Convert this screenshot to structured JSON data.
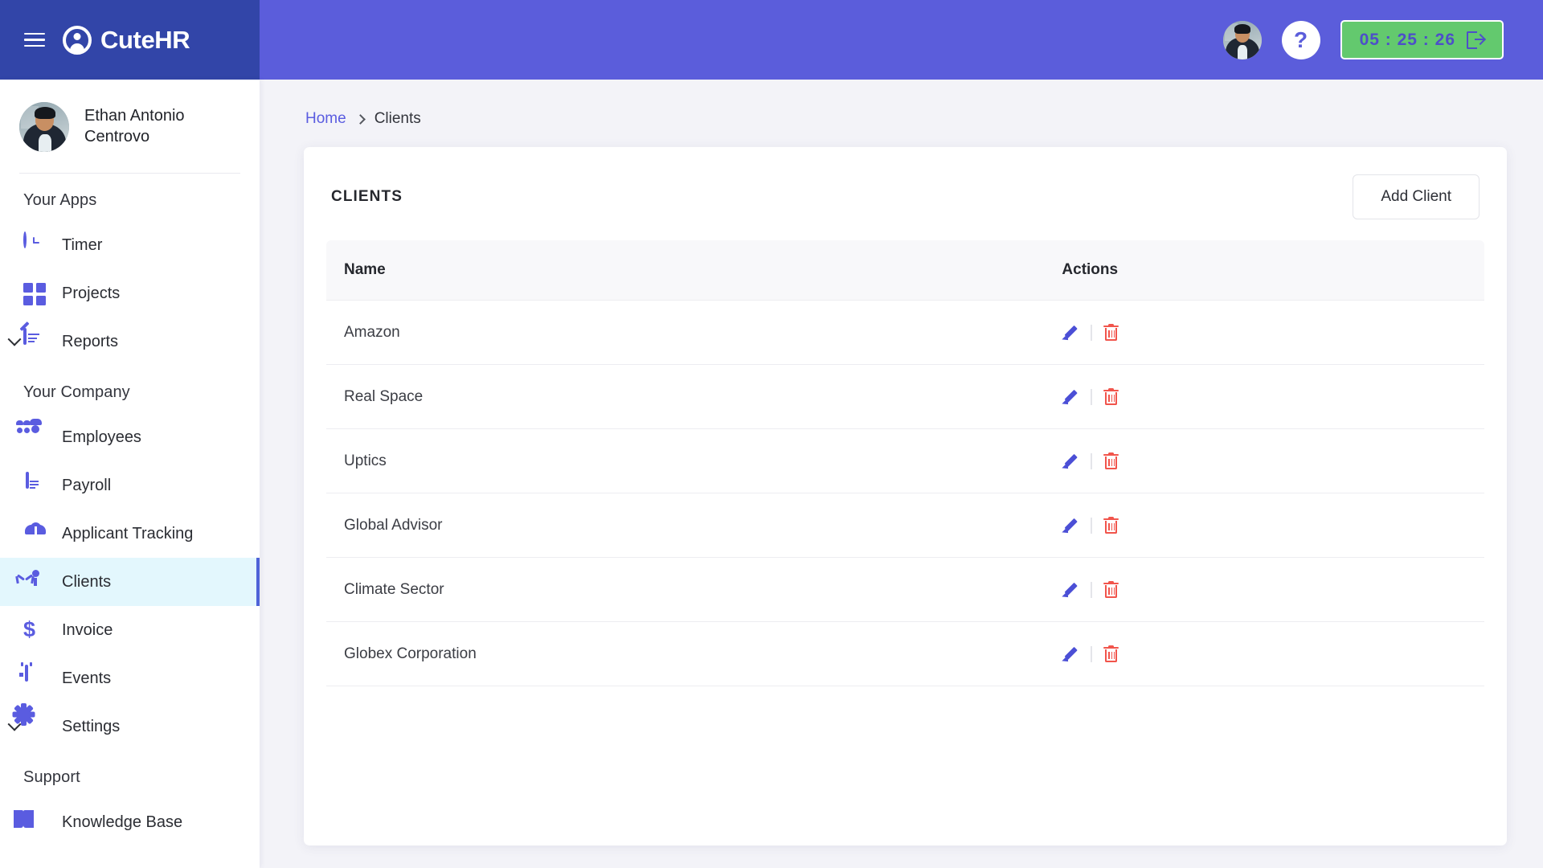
{
  "brand": {
    "name": "CuteHR",
    "collapse_icon": "collapse-sidebar-icon",
    "logo_icon": "cutehr-logo-icon"
  },
  "header": {
    "avatar_icon": "user-avatar",
    "help_icon": "help-question-icon",
    "timer": {
      "value": "05 : 25 : 26",
      "icon": "clock-out-icon"
    }
  },
  "sidebar": {
    "profile": {
      "name": "Ethan Antonio Centrovo",
      "avatar_icon": "profile-avatar"
    },
    "groups": [
      {
        "title": "Your Apps",
        "items": [
          {
            "label": "Timer",
            "icon": "clock-icon",
            "expandable": false,
            "active": false
          },
          {
            "label": "Projects",
            "icon": "grid-icon",
            "expandable": false,
            "active": false
          },
          {
            "label": "Reports",
            "icon": "report-edit-icon",
            "expandable": true,
            "active": false
          }
        ]
      },
      {
        "title": "Your Company",
        "items": [
          {
            "label": "Employees",
            "icon": "people-icon",
            "expandable": false,
            "active": false
          },
          {
            "label": "Payroll",
            "icon": "payroll-document-icon",
            "expandable": false,
            "active": false
          },
          {
            "label": "Applicant Tracking",
            "icon": "person-tie-icon",
            "expandable": false,
            "active": false
          },
          {
            "label": "Clients",
            "icon": "client-person-icon",
            "expandable": false,
            "active": true
          },
          {
            "label": "Invoice",
            "icon": "dollar-icon",
            "expandable": false,
            "active": false
          },
          {
            "label": "Events",
            "icon": "calendar-icon",
            "expandable": false,
            "active": false
          },
          {
            "label": "Settings",
            "icon": "gear-icon",
            "expandable": true,
            "active": false
          }
        ]
      },
      {
        "title": "Support",
        "items": [
          {
            "label": "Knowledge Base",
            "icon": "book-icon",
            "expandable": false,
            "active": false
          }
        ]
      }
    ]
  },
  "breadcrumb": {
    "home": "Home",
    "separator": "chevron-right-icon",
    "current": "Clients"
  },
  "card": {
    "title": "CLIENTS",
    "add_button": "Add Client",
    "columns": [
      "Name",
      "Actions"
    ],
    "rows": [
      {
        "name": "Amazon",
        "edit_icon": "edit-pencil-icon",
        "delete_icon": "trash-icon"
      },
      {
        "name": "Real Space",
        "edit_icon": "edit-pencil-icon",
        "delete_icon": "trash-icon"
      },
      {
        "name": "Uptics",
        "edit_icon": "edit-pencil-icon",
        "delete_icon": "trash-icon"
      },
      {
        "name": "Global Advisor",
        "edit_icon": "edit-pencil-icon",
        "delete_icon": "trash-icon"
      },
      {
        "name": "Climate Sector",
        "edit_icon": "edit-pencil-icon",
        "delete_icon": "trash-icon"
      },
      {
        "name": "Globex Corporation",
        "edit_icon": "edit-pencil-icon",
        "delete_icon": "trash-icon"
      }
    ]
  },
  "colors": {
    "brand_dark": "#3245a8",
    "header": "#5b5ddb",
    "accent": "#5a5ce0",
    "timer_green": "#63c96e",
    "active_item_bg": "#e3f7fd",
    "active_item_border": "#4f63d8",
    "danger": "#f1554c",
    "page_bg": "#f3f3f8"
  }
}
